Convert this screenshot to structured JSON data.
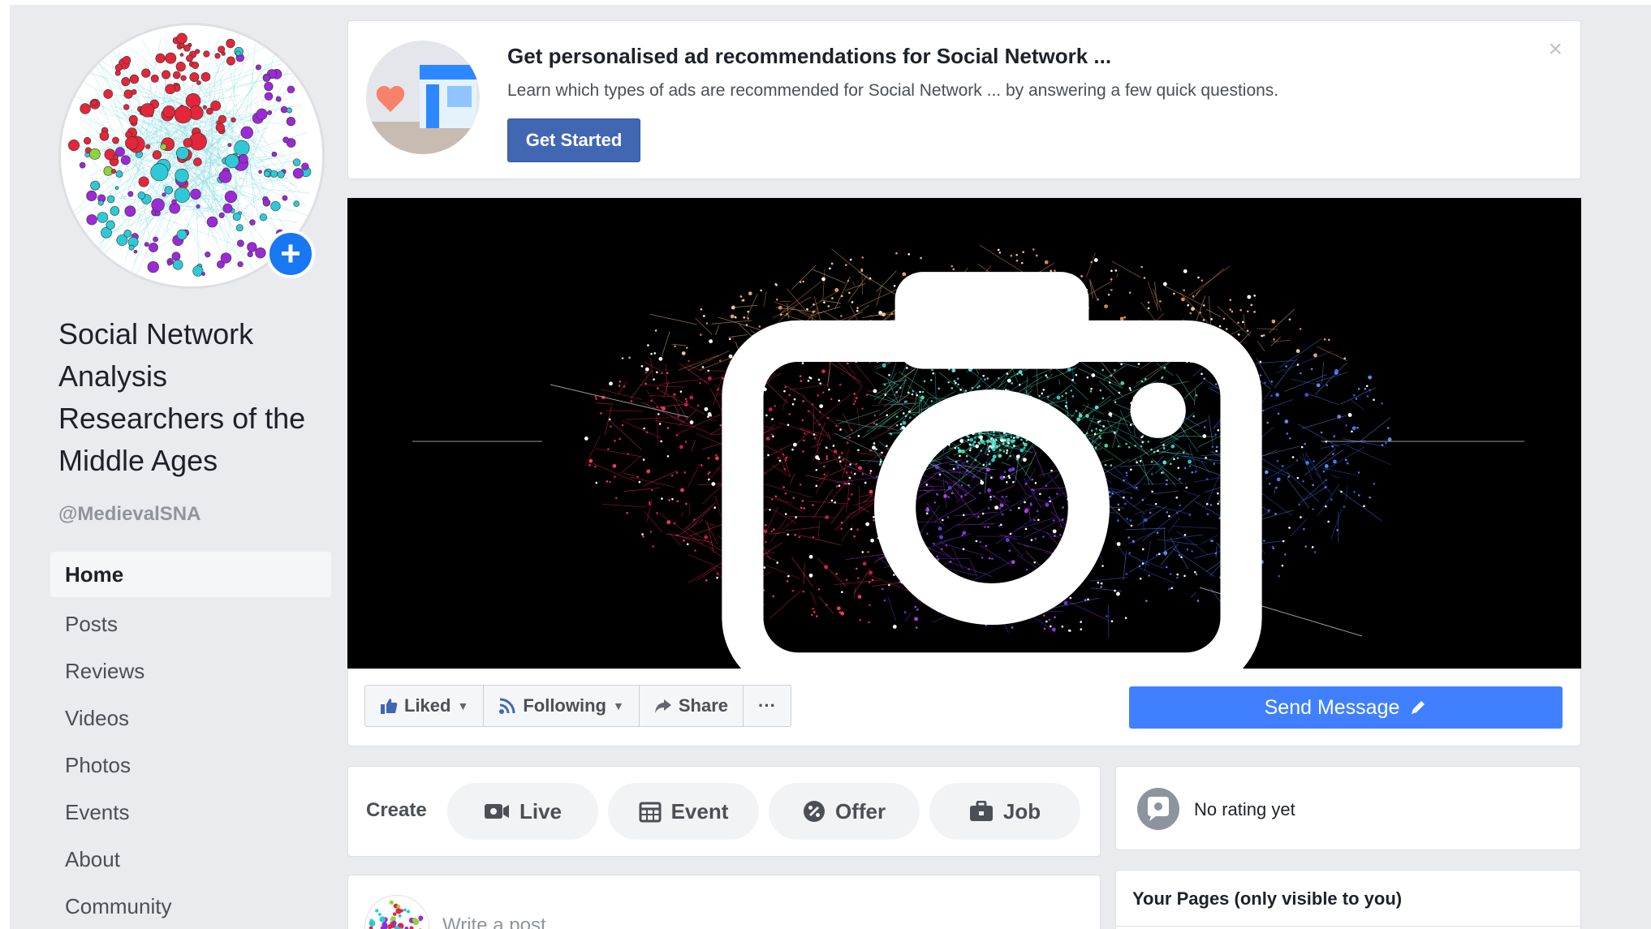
{
  "ad": {
    "title": "Get personalised ad recommendations for Social Network ...",
    "description": "Learn which types of ads are recommended for Social Network ... by answering a few quick questions.",
    "button": "Get Started",
    "close": "×"
  },
  "profile": {
    "name": "Social Network Analysis Researchers of the Middle Ages",
    "handle": "@MedievalSNA",
    "add_icon": "plus-icon"
  },
  "nav": {
    "items": [
      {
        "label": "Home",
        "active": true
      },
      {
        "label": "Posts"
      },
      {
        "label": "Reviews"
      },
      {
        "label": "Videos"
      },
      {
        "label": "Photos"
      },
      {
        "label": "Events"
      },
      {
        "label": "About"
      },
      {
        "label": "Community"
      }
    ]
  },
  "actions": {
    "liked": "Liked",
    "following": "Following",
    "share": "Share",
    "more": "···",
    "send_message": "Send Message"
  },
  "create": {
    "label": "Create",
    "live": "Live",
    "event": "Event",
    "offer": "Offer",
    "job": "Job"
  },
  "rating": {
    "text": "No rating yet"
  },
  "composer": {
    "placeholder": "Write a post..."
  },
  "your_pages": {
    "title": "Your Pages (only visible to you)"
  },
  "colors": {
    "brand_blue": "#4267b2",
    "send_blue": "#4080ff",
    "background": "#e9ebee"
  }
}
